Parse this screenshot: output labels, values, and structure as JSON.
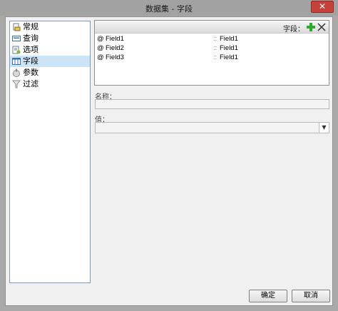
{
  "window": {
    "title": "数据集 - 字段",
    "close_glyph": "✕"
  },
  "nav": {
    "items": [
      {
        "label": "常规",
        "icon": "general-icon",
        "selected": false
      },
      {
        "label": "查询",
        "icon": "query-icon",
        "selected": false
      },
      {
        "label": "选项",
        "icon": "options-icon",
        "selected": false
      },
      {
        "label": "字段",
        "icon": "fields-icon",
        "selected": true
      },
      {
        "label": "参数",
        "icon": "parameters-icon",
        "selected": false
      },
      {
        "label": "过滤",
        "icon": "filter-icon",
        "selected": false
      }
    ]
  },
  "fields": {
    "header_label": "字段：",
    "add_icon": "plus-icon",
    "remove_icon": "close-icon",
    "rows": [
      {
        "at": "@",
        "name": "Field1",
        "sep": "::",
        "type": "Field1"
      },
      {
        "at": "@",
        "name": "Field2",
        "sep": "::",
        "type": "Field1"
      },
      {
        "at": "@",
        "name": "Field3",
        "sep": "::",
        "type": "Field1"
      }
    ]
  },
  "form": {
    "name_label": "名称：",
    "name_value": "",
    "value_label": "值：",
    "value_selected": ""
  },
  "buttons": {
    "ok": "确定",
    "cancel": "取消"
  },
  "colors": {
    "selection": "#cce4f7",
    "close_button": "#c7413b",
    "add_icon": "#2ea82e"
  }
}
